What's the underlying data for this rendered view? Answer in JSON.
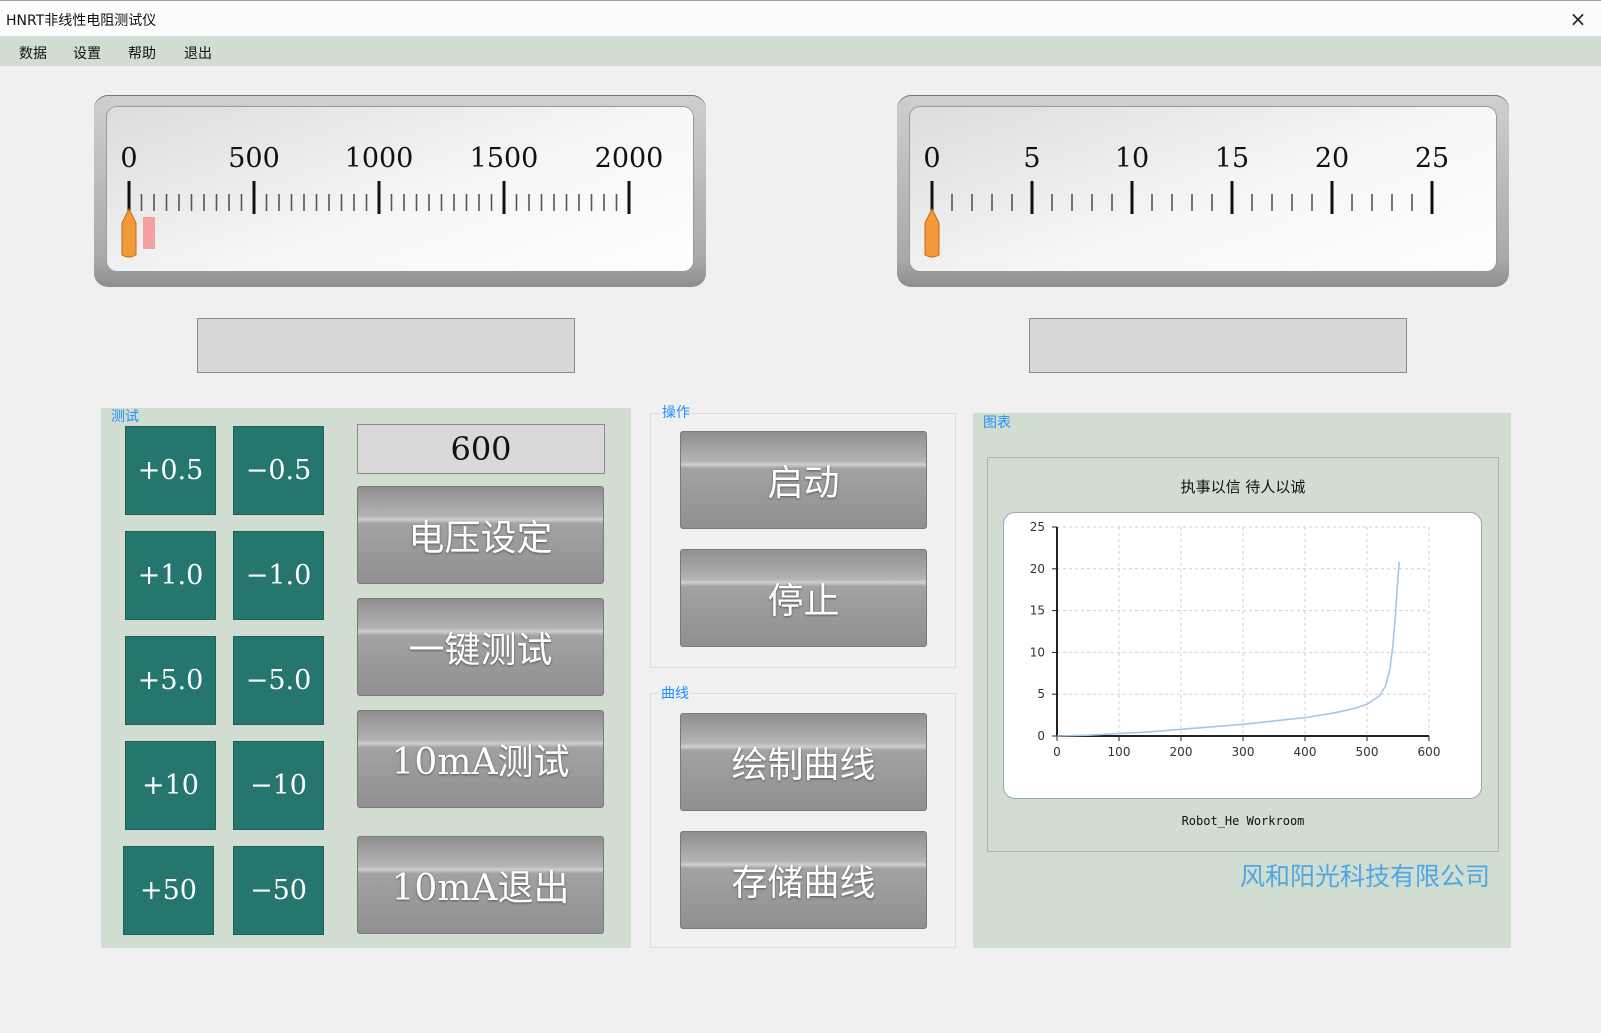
{
  "window": {
    "title": "HNRT非线性电阻测试仪",
    "close_icon": "×"
  },
  "menu": [
    "数据",
    "设置",
    "帮助",
    "退出"
  ],
  "meters": {
    "voltage": {
      "ticks": [
        "0",
        "500",
        "1000",
        "1500",
        "2000"
      ],
      "min": 0,
      "max": 2000,
      "value": 0,
      "marker_value": 80
    },
    "current": {
      "ticks": [
        "0",
        "5",
        "10",
        "15",
        "20",
        "25"
      ],
      "min": 0,
      "max": 25,
      "value": 0
    }
  },
  "readouts": {
    "voltage": "",
    "current": ""
  },
  "groups": {
    "test": "测试",
    "operation": "操作",
    "curve": "曲线",
    "chart": "图表"
  },
  "step_buttons": [
    [
      "+0.5",
      "−0.5"
    ],
    [
      "+1.0",
      "−1.0"
    ],
    [
      "+5.0",
      "−5.0"
    ],
    [
      "+10",
      "−10"
    ],
    [
      "+50",
      "−50"
    ]
  ],
  "voltage_value": "600",
  "test_buttons": [
    "电压设定",
    "一键测试",
    "10mA测试",
    "10mA退出"
  ],
  "operation_buttons": [
    "启动",
    "停止"
  ],
  "curve_buttons": [
    "绘制曲线",
    "存储曲线"
  ],
  "chart": {
    "title": "执事以信 待人以诚",
    "footer": "Robot_He Workroom"
  },
  "chart_data": {
    "type": "line",
    "title": "执事以信 待人以诚",
    "xlabel": "",
    "ylabel": "",
    "xlim": [
      0,
      600
    ],
    "ylim": [
      0,
      25
    ],
    "x_ticks": [
      "0",
      "100",
      "200",
      "300",
      "400",
      "500",
      "600"
    ],
    "y_ticks": [
      "0",
      "5",
      "10",
      "15",
      "20",
      "25"
    ],
    "grid": true,
    "series": [
      {
        "color": "#a9c4e2",
        "x": [
          0,
          50,
          100,
          150,
          200,
          250,
          300,
          350,
          400,
          450,
          480,
          500,
          520,
          530,
          537,
          542,
          546,
          549,
          552
        ],
        "y": [
          0.0,
          0.1,
          0.3,
          0.5,
          0.8,
          1.1,
          1.4,
          1.8,
          2.2,
          2.8,
          3.3,
          3.8,
          4.8,
          6.0,
          8.0,
          11.0,
          14.5,
          18.0,
          20.8
        ]
      }
    ]
  },
  "company": "风和阳光科技有限公司"
}
